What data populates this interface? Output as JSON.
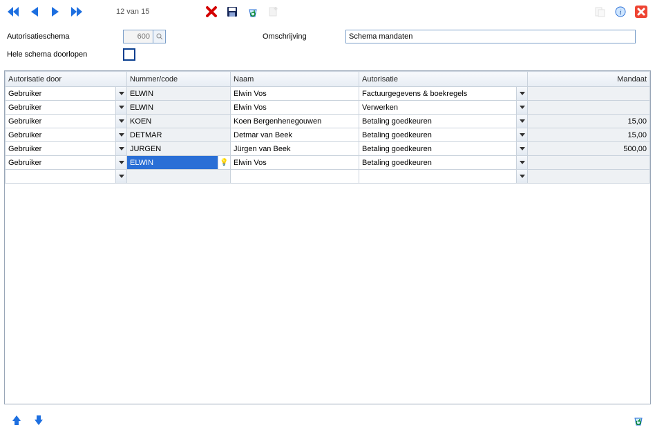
{
  "toolbar": {
    "counter": "12 van 15"
  },
  "form": {
    "schema_label": "Autorisatieschema",
    "schema_code": "600",
    "desc_label": "Omschrijving",
    "desc_value": "Schema mandaten",
    "doorlopen_label": "Hele schema doorlopen"
  },
  "grid": {
    "headers": {
      "auth_by": "Autorisatie door",
      "code": "Nummer/code",
      "name": "Naam",
      "role": "Autorisatie",
      "mandaat": "Mandaat"
    },
    "rows": [
      {
        "auth_by": "Gebruiker",
        "code": "ELWIN",
        "name": "Elwin Vos",
        "role": "Factuurgegevens & boekregels",
        "mandaat": ""
      },
      {
        "auth_by": "Gebruiker",
        "code": "ELWIN",
        "name": "Elwin Vos",
        "role": "Verwerken",
        "mandaat": ""
      },
      {
        "auth_by": "Gebruiker",
        "code": "KOEN",
        "name": "Koen Bergenhenegouwen",
        "role": "Betaling goedkeuren",
        "mandaat": "15,00"
      },
      {
        "auth_by": "Gebruiker",
        "code": "DETMAR",
        "name": "Detmar van Beek",
        "role": "Betaling goedkeuren",
        "mandaat": "15,00"
      },
      {
        "auth_by": "Gebruiker",
        "code": "JURGEN",
        "name": "Jürgen van Beek",
        "role": "Betaling goedkeuren",
        "mandaat": "500,00"
      },
      {
        "auth_by": "Gebruiker",
        "code": "ELWIN",
        "name": "Elwin Vos",
        "role": "Betaling goedkeuren",
        "mandaat": ""
      }
    ]
  }
}
